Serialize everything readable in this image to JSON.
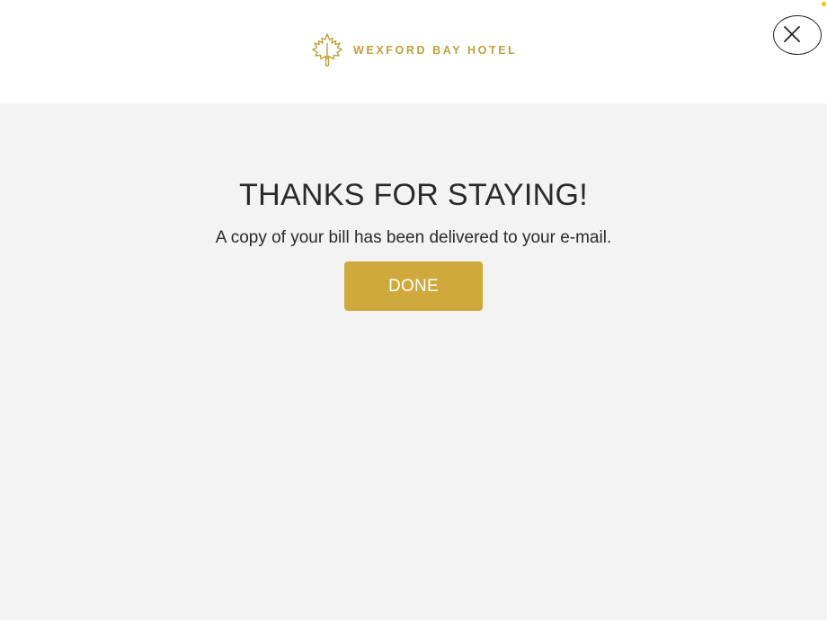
{
  "header": {
    "brand_name": "WEXFORD BAY HOTEL",
    "logo_icon": "maple-leaf-icon",
    "close_icon": "close-icon"
  },
  "main": {
    "title": "THANKS FOR STAYING!",
    "message": "A copy of your bill has been delivered to your e-mail.",
    "done_label": "DONE"
  },
  "colors": {
    "brand_gold": "#c3a03a",
    "button_gold": "#cfa93b",
    "background": "#f3f3f3",
    "header_background": "#ffffff",
    "text": "#2a2a2a"
  }
}
